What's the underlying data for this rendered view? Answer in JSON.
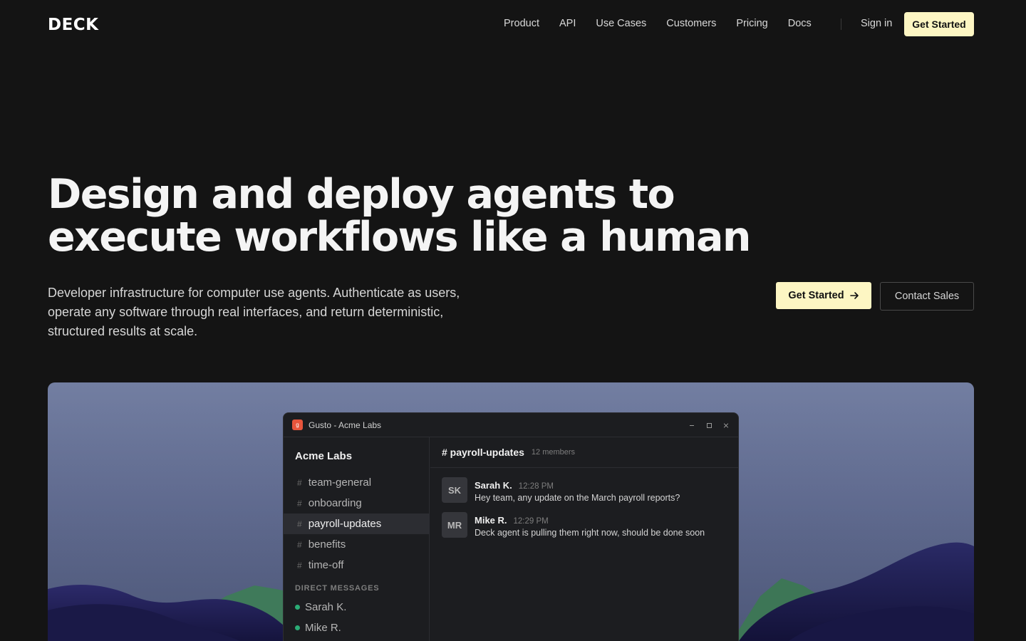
{
  "header": {
    "logo": "DECK",
    "nav": [
      "Product",
      "API",
      "Use Cases",
      "Customers",
      "Pricing",
      "Docs"
    ],
    "sign_in": "Sign in",
    "get_started": "Get Started"
  },
  "hero": {
    "title_lines": [
      "Design and deploy agents to",
      "execute workflows like a human"
    ],
    "subtitle_lines": [
      "Developer infrastructure for computer use agents. Authenticate as users,",
      "operate any software through real interfaces, and return deterministic,",
      "structured results at scale."
    ],
    "primary_cta": "Get Started",
    "primary_cta_icon": "arrow-right-icon",
    "secondary_cta": "Contact Sales"
  },
  "app_window": {
    "icon_letter": "g",
    "title": "Gusto - Acme Labs",
    "workspace": "Acme Labs",
    "channel_prefix": "#",
    "channels": [
      "team-general",
      "onboarding",
      "payroll-updates",
      "benefits",
      "time-off"
    ],
    "active_channel_index": 2,
    "dm_header": "DIRECT MESSAGES",
    "dms": [
      "Sarah K.",
      "Mike R."
    ],
    "chat": {
      "channel": "# payroll-updates",
      "members": "12 members",
      "messages": [
        {
          "initials": "SK",
          "author": "Sarah K.",
          "time": "12:28 PM",
          "text": "Hey team, any update on the March payroll reports?"
        },
        {
          "initials": "MR",
          "author": "Mike R.",
          "time": "12:29 PM",
          "text": "Deck agent is pulling them right now, should be done soon"
        }
      ]
    }
  },
  "colors": {
    "background": "#141414",
    "accent": "#fdf6c3",
    "app_icon": "#e8553c",
    "online_dot": "#2bac76"
  }
}
